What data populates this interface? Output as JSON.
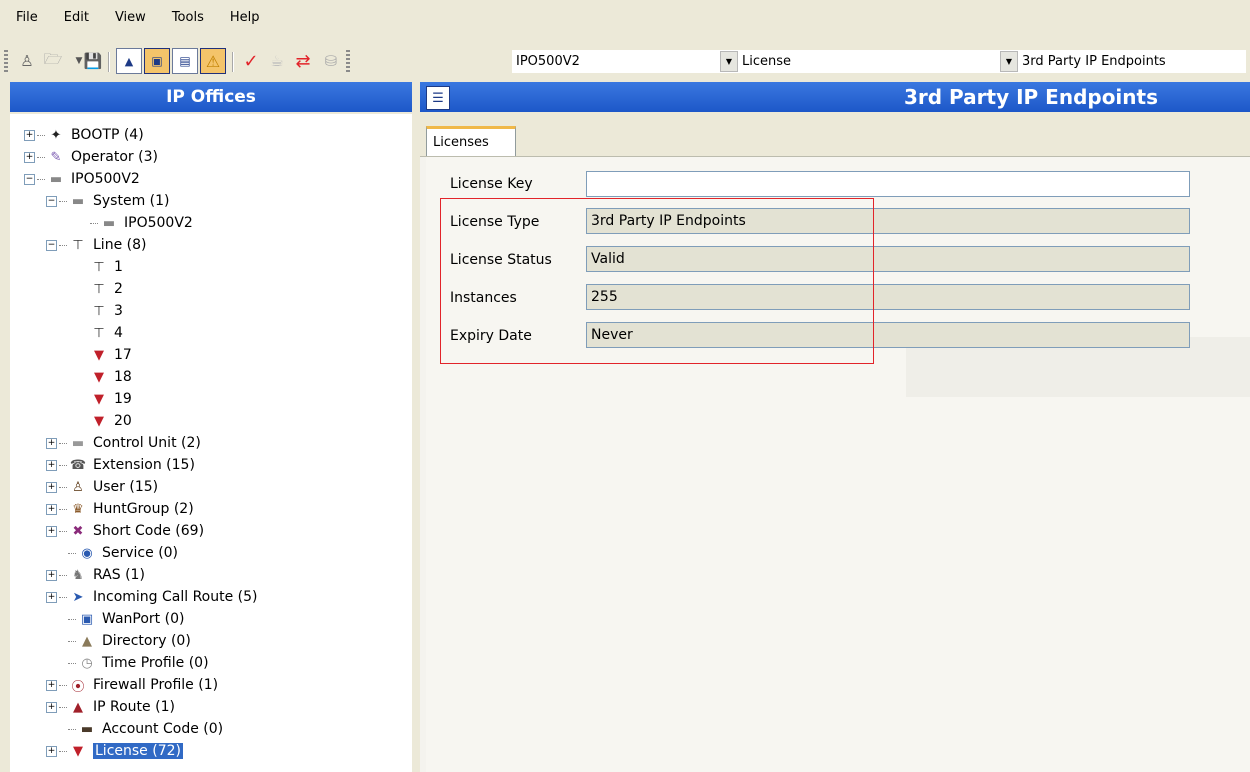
{
  "menu": [
    "File",
    "Edit",
    "View",
    "Tools",
    "Help"
  ],
  "toolbar": {
    "combo_ip_office": "IPO500V2",
    "combo_category": "License",
    "combo_item": "3rd Party IP Endpoints"
  },
  "left_panel": {
    "title": "IP Offices",
    "tree": [
      {
        "label": "BOOTP (4)"
      },
      {
        "label": "Operator (3)"
      },
      {
        "label": "IPO500V2"
      },
      {
        "label": "System (1)"
      },
      {
        "label": "IPO500V2"
      },
      {
        "label": "Line (8)"
      },
      {
        "label": "1"
      },
      {
        "label": "2"
      },
      {
        "label": "3"
      },
      {
        "label": "4"
      },
      {
        "label": "17"
      },
      {
        "label": "18"
      },
      {
        "label": "19"
      },
      {
        "label": "20"
      },
      {
        "label": "Control Unit (2)"
      },
      {
        "label": "Extension (15)"
      },
      {
        "label": "User (15)"
      },
      {
        "label": "HuntGroup (2)"
      },
      {
        "label": "Short Code (69)"
      },
      {
        "label": "Service (0)"
      },
      {
        "label": "RAS (1)"
      },
      {
        "label": "Incoming Call Route (5)"
      },
      {
        "label": "WanPort (0)"
      },
      {
        "label": "Directory (0)"
      },
      {
        "label": "Time Profile (0)"
      },
      {
        "label": "Firewall Profile (1)"
      },
      {
        "label": "IP Route (1)"
      },
      {
        "label": "Account Code (0)"
      },
      {
        "label": "License (72)"
      }
    ]
  },
  "right_panel": {
    "title": "3rd Party IP Endpoints",
    "tab": "Licenses",
    "fields": {
      "license_key": {
        "label": "License Key",
        "value": ""
      },
      "license_type": {
        "label": "License Type",
        "value": "3rd Party IP Endpoints"
      },
      "license_status": {
        "label": "License Status",
        "value": "Valid"
      },
      "instances": {
        "label": "Instances",
        "value": "255"
      },
      "expiry_date": {
        "label": "Expiry Date",
        "value": "Never"
      }
    }
  },
  "colors": {
    "header_blue": "#1d57c8",
    "highlight_red": "#e2242a",
    "selected_blue": "#316ac5"
  }
}
